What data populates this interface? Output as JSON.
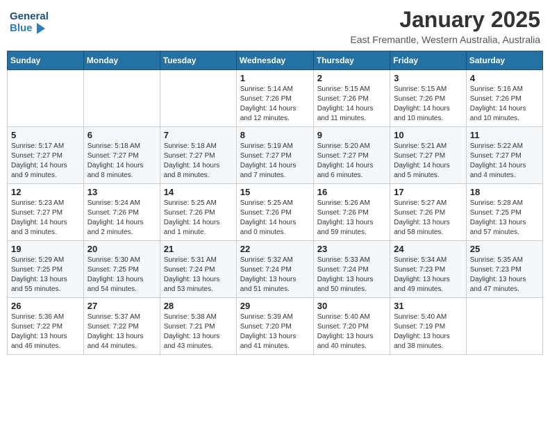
{
  "header": {
    "logo_text_1": "General",
    "logo_text_2": "Blue",
    "month": "January 2025",
    "location": "East Fremantle, Western Australia, Australia"
  },
  "weekdays": [
    "Sunday",
    "Monday",
    "Tuesday",
    "Wednesday",
    "Thursday",
    "Friday",
    "Saturday"
  ],
  "weeks": [
    [
      {
        "day": null,
        "info": null
      },
      {
        "day": null,
        "info": null
      },
      {
        "day": null,
        "info": null
      },
      {
        "day": "1",
        "info": "Sunrise: 5:14 AM\nSunset: 7:26 PM\nDaylight: 14 hours\nand 12 minutes."
      },
      {
        "day": "2",
        "info": "Sunrise: 5:15 AM\nSunset: 7:26 PM\nDaylight: 14 hours\nand 11 minutes."
      },
      {
        "day": "3",
        "info": "Sunrise: 5:15 AM\nSunset: 7:26 PM\nDaylight: 14 hours\nand 10 minutes."
      },
      {
        "day": "4",
        "info": "Sunrise: 5:16 AM\nSunset: 7:26 PM\nDaylight: 14 hours\nand 10 minutes."
      }
    ],
    [
      {
        "day": "5",
        "info": "Sunrise: 5:17 AM\nSunset: 7:27 PM\nDaylight: 14 hours\nand 9 minutes."
      },
      {
        "day": "6",
        "info": "Sunrise: 5:18 AM\nSunset: 7:27 PM\nDaylight: 14 hours\nand 8 minutes."
      },
      {
        "day": "7",
        "info": "Sunrise: 5:18 AM\nSunset: 7:27 PM\nDaylight: 14 hours\nand 8 minutes."
      },
      {
        "day": "8",
        "info": "Sunrise: 5:19 AM\nSunset: 7:27 PM\nDaylight: 14 hours\nand 7 minutes."
      },
      {
        "day": "9",
        "info": "Sunrise: 5:20 AM\nSunset: 7:27 PM\nDaylight: 14 hours\nand 6 minutes."
      },
      {
        "day": "10",
        "info": "Sunrise: 5:21 AM\nSunset: 7:27 PM\nDaylight: 14 hours\nand 5 minutes."
      },
      {
        "day": "11",
        "info": "Sunrise: 5:22 AM\nSunset: 7:27 PM\nDaylight: 14 hours\nand 4 minutes."
      }
    ],
    [
      {
        "day": "12",
        "info": "Sunrise: 5:23 AM\nSunset: 7:27 PM\nDaylight: 14 hours\nand 3 minutes."
      },
      {
        "day": "13",
        "info": "Sunrise: 5:24 AM\nSunset: 7:26 PM\nDaylight: 14 hours\nand 2 minutes."
      },
      {
        "day": "14",
        "info": "Sunrise: 5:25 AM\nSunset: 7:26 PM\nDaylight: 14 hours\nand 1 minute."
      },
      {
        "day": "15",
        "info": "Sunrise: 5:25 AM\nSunset: 7:26 PM\nDaylight: 14 hours\nand 0 minutes."
      },
      {
        "day": "16",
        "info": "Sunrise: 5:26 AM\nSunset: 7:26 PM\nDaylight: 13 hours\nand 59 minutes."
      },
      {
        "day": "17",
        "info": "Sunrise: 5:27 AM\nSunset: 7:26 PM\nDaylight: 13 hours\nand 58 minutes."
      },
      {
        "day": "18",
        "info": "Sunrise: 5:28 AM\nSunset: 7:25 PM\nDaylight: 13 hours\nand 57 minutes."
      }
    ],
    [
      {
        "day": "19",
        "info": "Sunrise: 5:29 AM\nSunset: 7:25 PM\nDaylight: 13 hours\nand 55 minutes."
      },
      {
        "day": "20",
        "info": "Sunrise: 5:30 AM\nSunset: 7:25 PM\nDaylight: 13 hours\nand 54 minutes."
      },
      {
        "day": "21",
        "info": "Sunrise: 5:31 AM\nSunset: 7:24 PM\nDaylight: 13 hours\nand 53 minutes."
      },
      {
        "day": "22",
        "info": "Sunrise: 5:32 AM\nSunset: 7:24 PM\nDaylight: 13 hours\nand 51 minutes."
      },
      {
        "day": "23",
        "info": "Sunrise: 5:33 AM\nSunset: 7:24 PM\nDaylight: 13 hours\nand 50 minutes."
      },
      {
        "day": "24",
        "info": "Sunrise: 5:34 AM\nSunset: 7:23 PM\nDaylight: 13 hours\nand 49 minutes."
      },
      {
        "day": "25",
        "info": "Sunrise: 5:35 AM\nSunset: 7:23 PM\nDaylight: 13 hours\nand 47 minutes."
      }
    ],
    [
      {
        "day": "26",
        "info": "Sunrise: 5:36 AM\nSunset: 7:22 PM\nDaylight: 13 hours\nand 46 minutes."
      },
      {
        "day": "27",
        "info": "Sunrise: 5:37 AM\nSunset: 7:22 PM\nDaylight: 13 hours\nand 44 minutes."
      },
      {
        "day": "28",
        "info": "Sunrise: 5:38 AM\nSunset: 7:21 PM\nDaylight: 13 hours\nand 43 minutes."
      },
      {
        "day": "29",
        "info": "Sunrise: 5:39 AM\nSunset: 7:20 PM\nDaylight: 13 hours\nand 41 minutes."
      },
      {
        "day": "30",
        "info": "Sunrise: 5:40 AM\nSunset: 7:20 PM\nDaylight: 13 hours\nand 40 minutes."
      },
      {
        "day": "31",
        "info": "Sunrise: 5:40 AM\nSunset: 7:19 PM\nDaylight: 13 hours\nand 38 minutes."
      },
      {
        "day": null,
        "info": null
      }
    ]
  ]
}
